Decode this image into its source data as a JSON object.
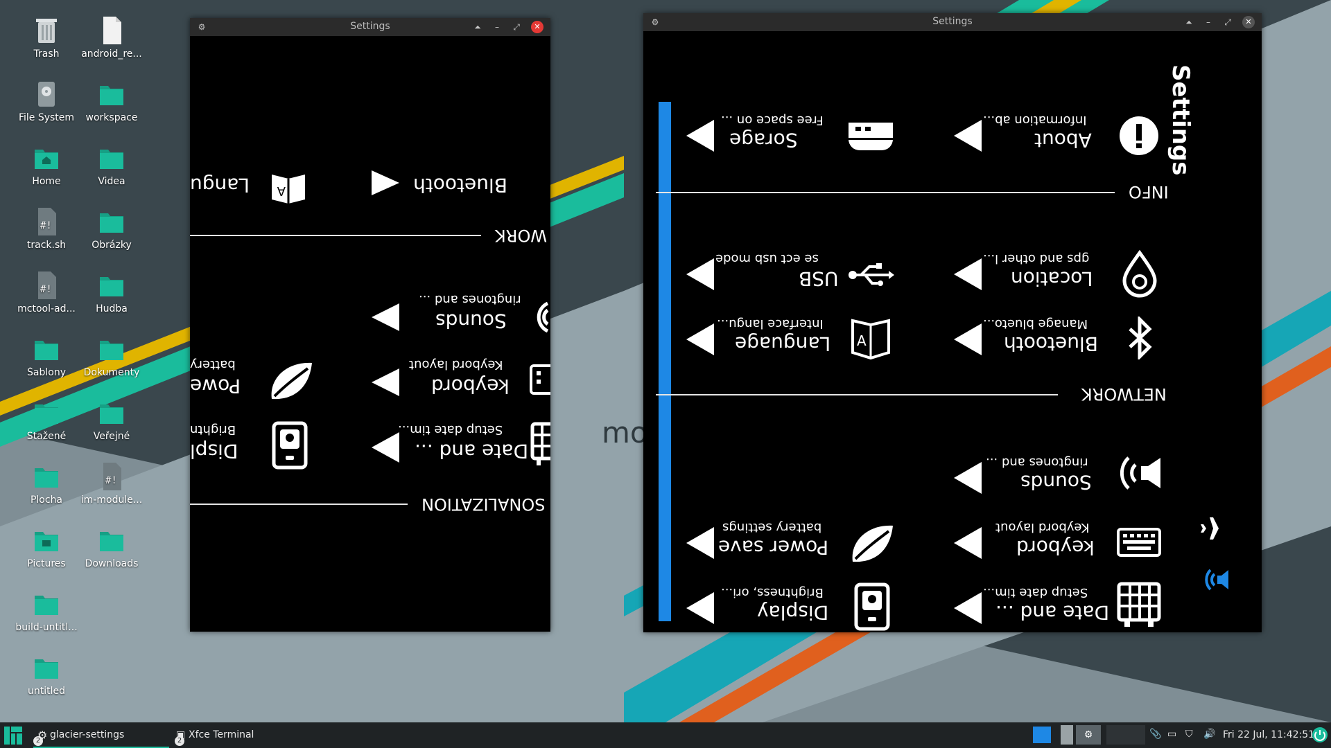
{
  "colors": {
    "accent": "#1e88e5",
    "teal": "#16a085",
    "folder": "#1abc9c",
    "close": "#e53935"
  },
  "desktop": {
    "icons": [
      {
        "label": "Trash",
        "icon": "trash-icon"
      },
      {
        "label": "android_re...",
        "icon": "file-icon"
      },
      {
        "label": "File System",
        "icon": "drive-icon"
      },
      {
        "label": "workspace",
        "icon": "folder-icon"
      },
      {
        "label": "Home",
        "icon": "home-folder-icon"
      },
      {
        "label": "Videa",
        "icon": "folder-icon"
      },
      {
        "label": "track.sh",
        "icon": "script-icon"
      },
      {
        "label": "Obrázky",
        "icon": "folder-icon"
      },
      {
        "label": "mctool-ad...",
        "icon": "script-icon"
      },
      {
        "label": "Hudba",
        "icon": "folder-icon"
      },
      {
        "label": "Šablony",
        "icon": "folder-icon"
      },
      {
        "label": "Dokumenty",
        "icon": "folder-icon"
      },
      {
        "label": "Stažené",
        "icon": "folder-icon"
      },
      {
        "label": "Veřejné",
        "icon": "folder-icon"
      },
      {
        "label": "Plocha",
        "icon": "folder-icon"
      },
      {
        "label": "im-module...",
        "icon": "script-icon"
      },
      {
        "label": "Pictures",
        "icon": "pictures-folder-icon"
      },
      {
        "label": "Downloads",
        "icon": "folder-icon"
      },
      {
        "label": "build-untitl...",
        "icon": "folder-icon"
      },
      {
        "label": "untitled",
        "icon": "folder-icon"
      }
    ],
    "wallpaper_text": "mo"
  },
  "win_small": {
    "title": "Settings",
    "sections": {
      "network": "WORK",
      "personalization": "SONALIZATION"
    },
    "items": {
      "bluetooth": "Bluetooth",
      "language": "Langu",
      "sounds_title": "Sounds",
      "sounds_sub": "ringtones and ...",
      "keyboard_title": "keybord",
      "keyboard_sub": "Keybord layout",
      "power_title": "Powe",
      "power_sub": "battery",
      "date_title": "Date and ...",
      "date_sub": "Setup date tim...",
      "display_title": "Displ",
      "display_sub": "Brightn"
    }
  },
  "win_large": {
    "title": "Settings",
    "header": "Settings",
    "sections": {
      "info": "INFO",
      "network": "NETWORK"
    },
    "items": {
      "about_title": "About",
      "about_sub": "Information ab...",
      "storage_title": "Sorage",
      "storage_sub": "Free space on ...",
      "location_title": "Location",
      "location_sub": "gps and other l...",
      "usb_title": "USB",
      "usb_sub": "se ect usb mode",
      "bluetooth_title": "Bluetooth",
      "bluetooth_sub": "Manage blueto...",
      "language_title": "Language",
      "language_sub": "Interface langu...",
      "sounds_title": "Sounds",
      "sounds_sub": "ringtones and ...",
      "keyboard_title": "keybord",
      "keyboard_sub": "Keybord layout",
      "power_title": "Power save",
      "power_sub": "battery settings",
      "date_title": "Date and ...",
      "date_sub": "Setup date tim...",
      "display_title": "Display",
      "display_sub": "Brightness, ori..."
    }
  },
  "taskbar": {
    "tasks": [
      {
        "label": "glacier-settings",
        "badge": "2"
      },
      {
        "label": "Xfce Terminal",
        "badge": "2"
      }
    ],
    "clock": "Fri 22 Jul, 11:42:51"
  }
}
